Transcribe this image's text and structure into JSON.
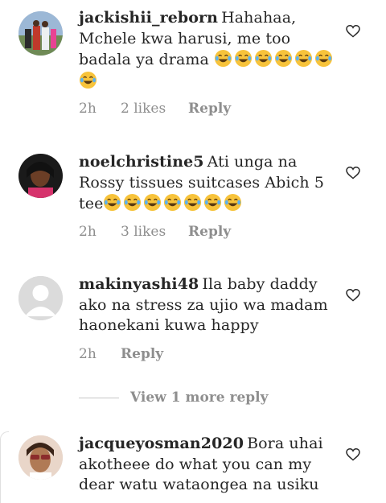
{
  "comments": [
    {
      "username": "jackishii_reborn",
      "text": "Hahahaa, Mchele kwa harusi, me too badala ya drama",
      "emoji_count": 7,
      "time": "2h",
      "likes": "2 likes",
      "reply": "Reply"
    },
    {
      "username": "noelchristine5",
      "text": "Ati unga na Rossy tissues suitcases Abich 5 tee",
      "emoji_count": 7,
      "time": "2h",
      "likes": "3 likes",
      "reply": "Reply"
    },
    {
      "username": "makinyashi48",
      "text": "Ila baby daddy ako na stress za ujio wa madam haonekani kuwa happy",
      "emoji_count": 0,
      "time": "2h",
      "likes": "",
      "reply": "Reply"
    },
    {
      "username": "jacqueyosman2020",
      "text": "Bora uhai akotheee do what you can my dear watu wataongea na usiku",
      "emoji_count": 0,
      "time": "",
      "likes": "",
      "reply": ""
    }
  ],
  "view_more_replies": "View 1 more reply",
  "icons": {
    "like": "heart-outline-icon",
    "emoji": "face-with-tears-of-joy-icon"
  },
  "colors": {
    "text": "#262626",
    "secondary": "#8e8e8e",
    "emoji": "#f7c33b"
  }
}
